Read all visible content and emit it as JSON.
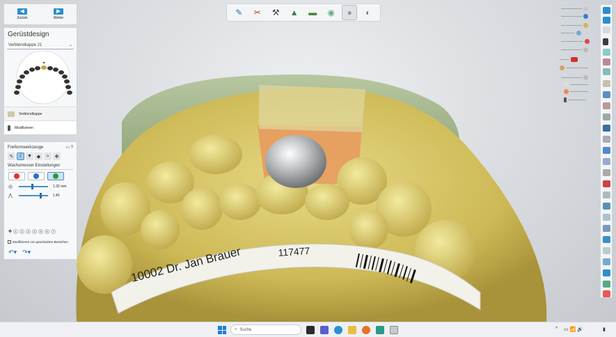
{
  "nav": {
    "back_label": "Zurück",
    "next_label": "Weiter"
  },
  "design": {
    "title": "Gerüstdesign",
    "selected_item": "Verblendkappe 21",
    "steps": [
      {
        "label": "Verblendkappe"
      },
      {
        "label": "Modifizieren"
      }
    ]
  },
  "tools": {
    "title": "Freiformwerkzeuge",
    "section_label": "Wachsmesser Einstellungen",
    "slider_values": [
      "1.32 mm",
      "1.40"
    ],
    "numbers": [
      "1",
      "2",
      "3",
      "4",
      "5",
      "6",
      "7"
    ],
    "checkbox_label": "Modifizieren von geschützten Bereichen"
  },
  "model_label": {
    "line1": "10002   Dr. Jan Brauer",
    "line2": "117477"
  },
  "taskbar": {
    "search_placeholder": "Suche"
  },
  "colors": {
    "accent": "#2a8fd0",
    "model_yellow": "#d8c66a",
    "background": "#d5d8dc"
  },
  "icons": {
    "top_toolbar": [
      "brush-icon",
      "scissors-icon",
      "wax-knife-icon",
      "crown-shape-icon",
      "model-icon",
      "cap-icon",
      "sphere-icon",
      "metal-sphere-icon"
    ]
  }
}
